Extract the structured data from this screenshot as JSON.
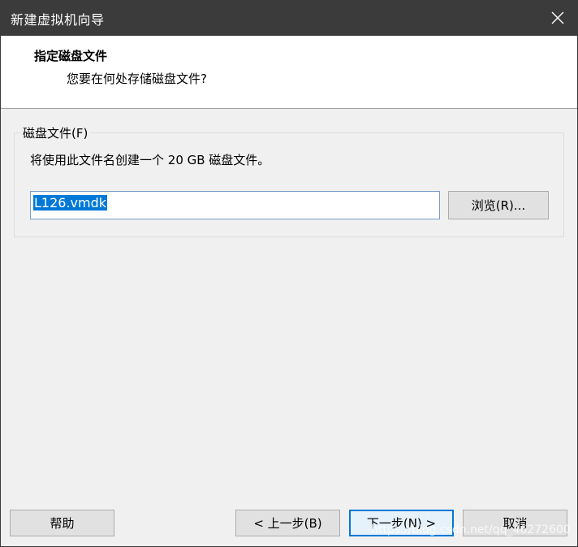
{
  "window": {
    "title": "新建虚拟机向导",
    "close_icon": "close-icon"
  },
  "header": {
    "title": "指定磁盘文件",
    "subtitle": "您要在何处存储磁盘文件?"
  },
  "disk_file_group": {
    "legend": "磁盘文件(F)",
    "description": "将使用此文件名创建一个 20 GB 磁盘文件。",
    "filename_value": "L126.vmdk",
    "browse_label": "浏览(R)..."
  },
  "footer": {
    "help_label": "帮助",
    "back_label": "< 上一步(B)",
    "next_label": "下一步(N) >",
    "cancel_label": "取消"
  },
  "watermark": "https://blog.csdn.net/qq_46272600",
  "colors": {
    "titlebar": "#3b3b3b",
    "accent": "#0078d7",
    "selection": "#0078d7"
  }
}
